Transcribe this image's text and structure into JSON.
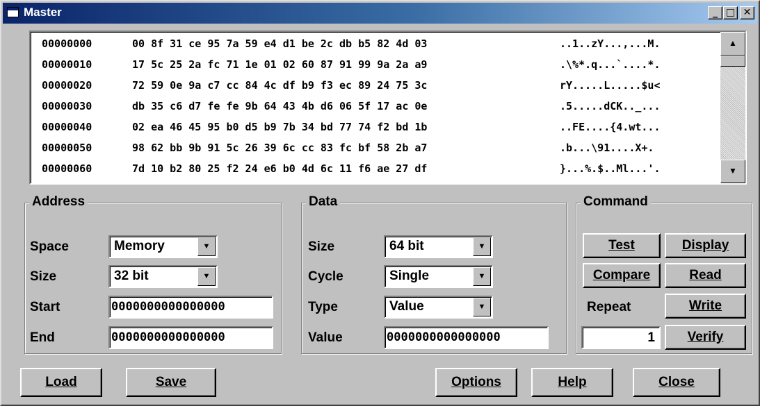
{
  "window": {
    "title": "Master",
    "minimize": "_",
    "maximize": "□",
    "close": "✕"
  },
  "hex_rows": [
    {
      "addr": "00000000",
      "bytes": "00 8f 31 ce 95 7a 59 e4 d1 be 2c db b5 82 4d 03",
      "ascii": "..1..zY...,...M."
    },
    {
      "addr": "00000010",
      "bytes": "17 5c 25 2a fc 71 1e 01 02 60 87 91 99 9a 2a a9",
      "ascii": ".\\%*.q...`....*."
    },
    {
      "addr": "00000020",
      "bytes": "72 59 0e 9a c7 cc 84 4c df b9 f3 ec 89 24 75 3c",
      "ascii": "rY.....L.....$u<"
    },
    {
      "addr": "00000030",
      "bytes": "db 35 c6 d7 fe fe 9b 64 43 4b d6 06 5f 17 ac 0e",
      "ascii": ".5.....dCK.._..."
    },
    {
      "addr": "00000040",
      "bytes": "02 ea 46 45 95 b0 d5 b9 7b 34 bd 77 74 f2 bd 1b",
      "ascii": "..FE....{4.wt..."
    },
    {
      "addr": "00000050",
      "bytes": "98 62 bb 9b 91 5c 26 39 6c cc 83 fc bf 58 2b a7",
      "ascii": ".b...\\91....X+."
    },
    {
      "addr": "00000060",
      "bytes": "7d 10 b2 80 25 f2 24 e6 b0 4d 6c 11 f6 ae 27 df",
      "ascii": "}...%.$..Ml...'."
    }
  ],
  "address": {
    "legend": "Address",
    "space_label": "Space",
    "space_value": "Memory",
    "size_label": "Size",
    "size_value": "32 bit",
    "start_label": "Start",
    "start_value": "0000000000000000",
    "end_label": "End",
    "end_value": "0000000000000000"
  },
  "data": {
    "legend": "Data",
    "size_label": "Size",
    "size_value": "64 bit",
    "cycle_label": "Cycle",
    "cycle_value": "Single",
    "type_label": "Type",
    "type_value": "Value",
    "value_label": "Value",
    "value_value": "0000000000000000"
  },
  "command": {
    "legend": "Command",
    "test": "Test",
    "display": "Display",
    "compare": "Compare",
    "read": "Read",
    "repeat_label": "Repeat",
    "repeat_value": "1",
    "write": "Write",
    "verify": "Verify"
  },
  "bottom": {
    "load": "Load",
    "save": "Save",
    "options": "Options",
    "help": "Help",
    "close": "Close"
  },
  "icons": {
    "scroll_up": "▲",
    "scroll_down": "▼",
    "combo_arrow": "▼"
  }
}
